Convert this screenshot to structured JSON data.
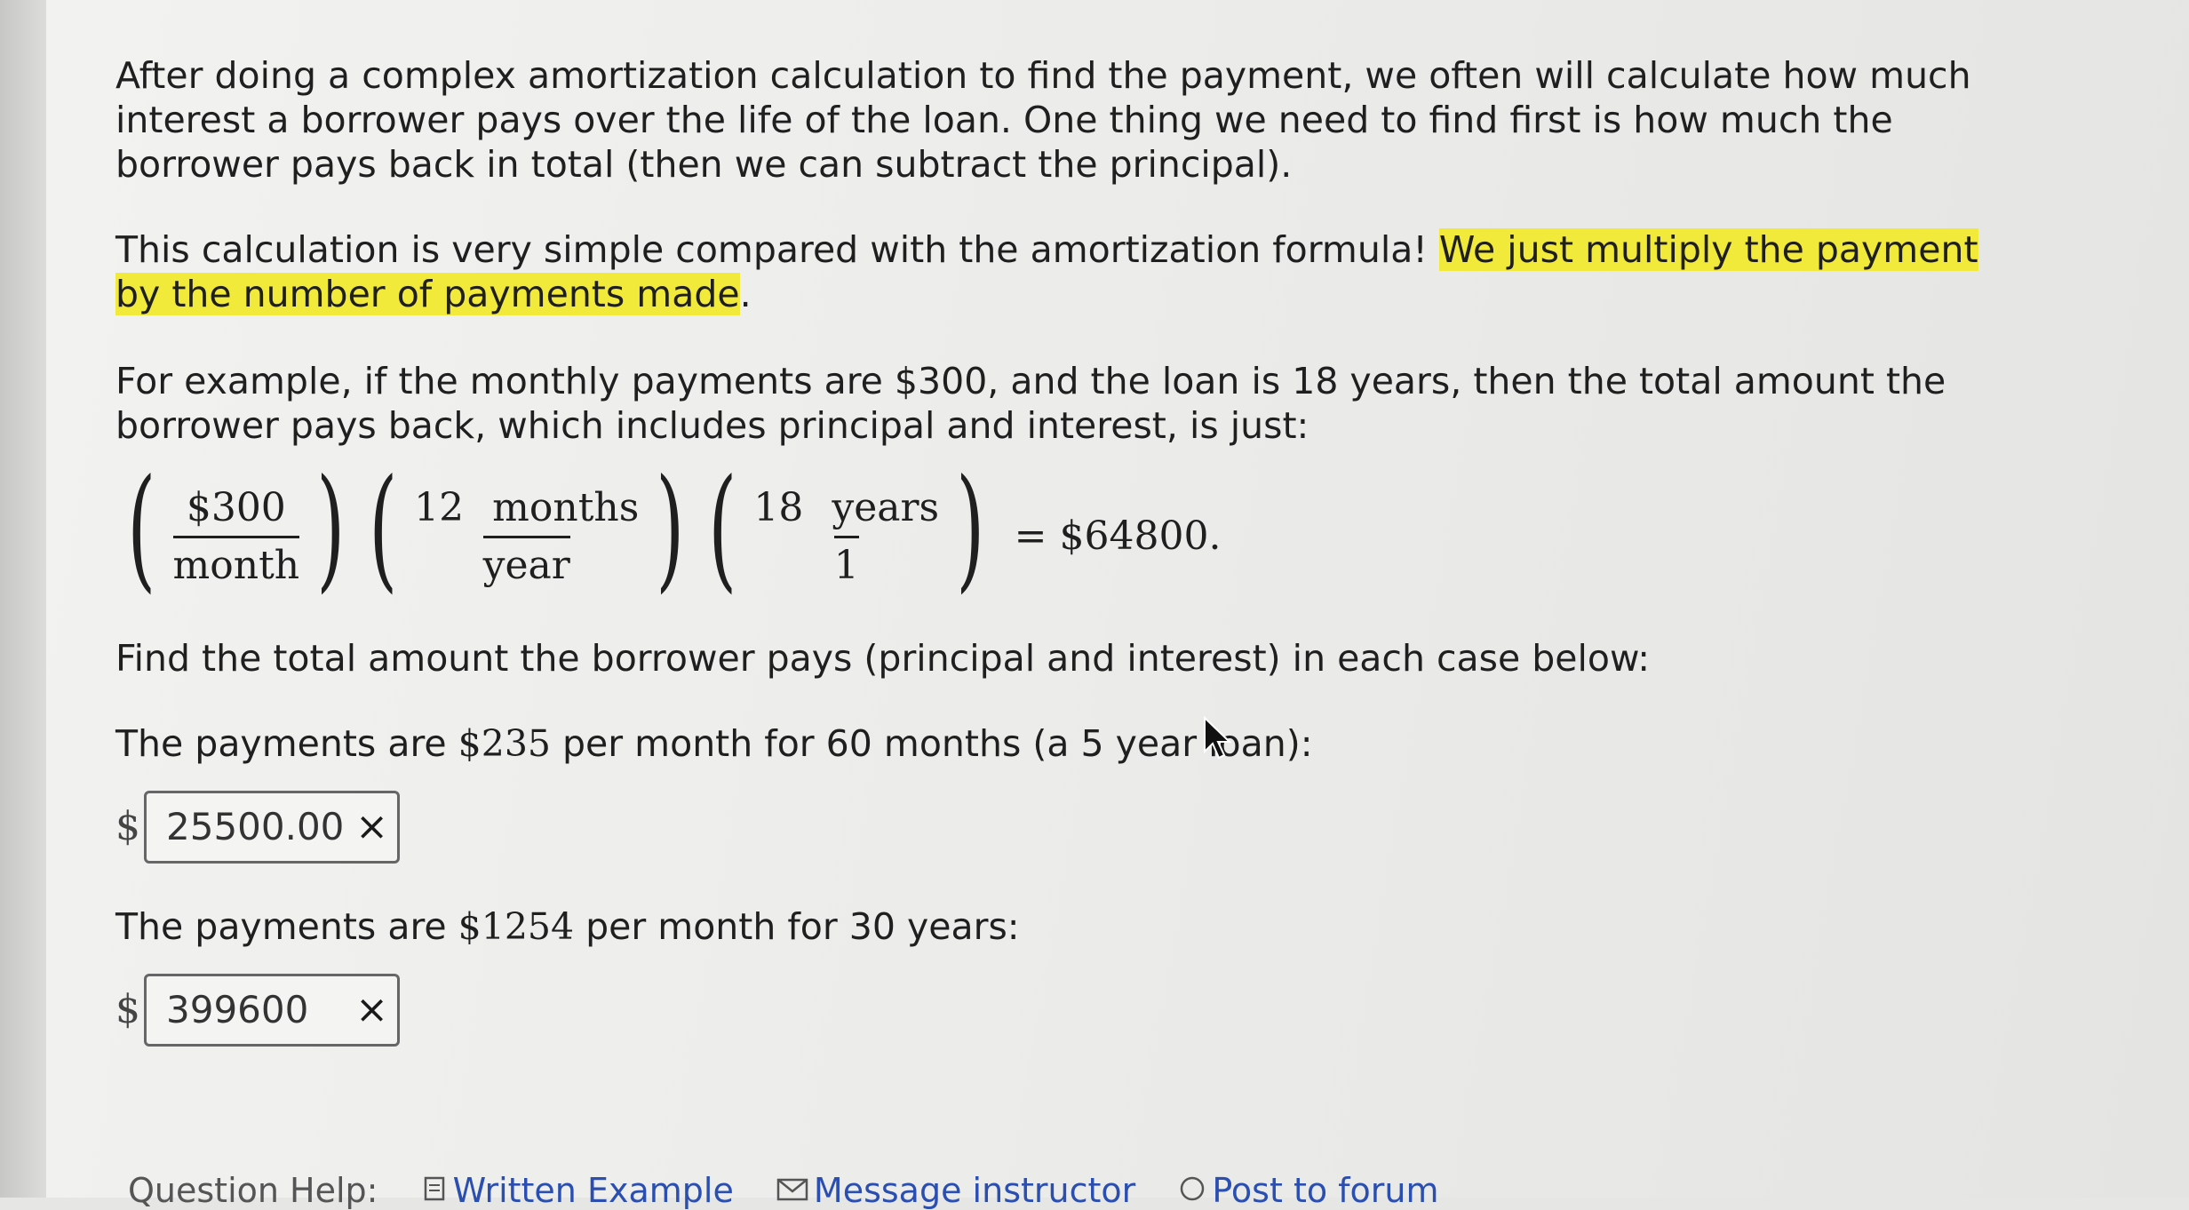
{
  "paragraphs": {
    "p1": "After doing a complex amortization calculation to find the payment, we often will calculate how much interest a borrower pays over the life of the loan. One thing we need to find first is how much the borrower pays back in total (then we can subtract the principal).",
    "p2_plain": "This calculation is very simple compared with the amortization formula! ",
    "p2_highlight": "We just multiply the payment by the number of payments made",
    "p2_end": ".",
    "p3": "For example, if the monthly payments are $300, and the loan is 18 years, then the total amount the borrower pays back, which includes principal and interest, is just:"
  },
  "formula": {
    "f1_num": "$300",
    "f1_den": "month",
    "f2_num_a": "12",
    "f2_num_b": "months",
    "f2_den": "year",
    "f3_num_a": "18",
    "f3_num_b": "years",
    "f3_den": "1",
    "result": "= $64800."
  },
  "prompt": "Find the total amount the borrower pays (principal and interest) in each case below:",
  "questions": [
    {
      "text_a": "The payments are ",
      "amount": "$235",
      "text_b": " per month for 60 months (a 5 year loan):",
      "currency": "$",
      "answer": "25500.00",
      "status_icon": "×"
    },
    {
      "text_a": "The payments are ",
      "amount": "$1254",
      "text_b": " per month for 30 years:",
      "currency": "$",
      "answer": "399600",
      "status_icon": "×"
    }
  ],
  "help": {
    "label": "Question Help:",
    "written_example": "Written Example",
    "message_instructor": "Message instructor",
    "post_to_forum": "Post to forum"
  },
  "colors": {
    "highlight": "#f2ea3a",
    "link": "#2a4fb0"
  }
}
